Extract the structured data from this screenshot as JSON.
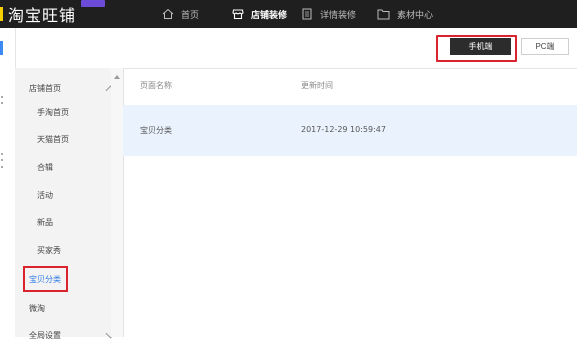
{
  "app": {
    "logo_text": "淘宝旺铺"
  },
  "topnav": {
    "items": [
      {
        "label": "首页",
        "icon": "home-icon"
      },
      {
        "label": "店铺装修",
        "icon": "store-icon",
        "active": true
      },
      {
        "label": "详情装修",
        "icon": "document-icon"
      },
      {
        "label": "素材中心",
        "icon": "folder-icon"
      }
    ]
  },
  "toolbar": {
    "mobile_label": "手机端",
    "pc_label": "PC端",
    "selected": "手机端"
  },
  "sidebar": {
    "group_title": "店铺首页",
    "items": [
      "手淘首页",
      "天猫首页",
      "合辑",
      "活动",
      "新品",
      "买家秀",
      "宝贝分类"
    ],
    "selected": "宝贝分类",
    "other_items": [
      "微淘",
      "全局设置"
    ]
  },
  "table": {
    "headers": [
      "页面名称",
      "更新时间"
    ],
    "rows": [
      {
        "name": "宝贝分类",
        "updated": "2017-12-29 10:59:47"
      }
    ]
  },
  "colors": {
    "accent": "#2d7be5",
    "highlight": "#d9232d",
    "topbar": "#1f1f1f",
    "selected_row": "#eaf3fd"
  }
}
